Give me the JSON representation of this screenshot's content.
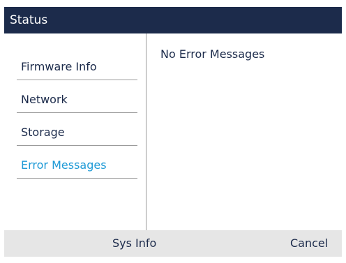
{
  "title": "Status",
  "menu": {
    "items": [
      {
        "label": "Firmware Info",
        "active": false
      },
      {
        "label": "Network",
        "active": false
      },
      {
        "label": "Storage",
        "active": false
      },
      {
        "label": "Error Messages",
        "active": true
      }
    ]
  },
  "content": {
    "message": "No Error Messages"
  },
  "softkeys": {
    "sys_info": "Sys Info",
    "cancel": "Cancel"
  },
  "colors": {
    "titlebar_bg": "#1c2b4b",
    "active_item": "#1e9ad6",
    "softkey_bg": "#e6e6e6",
    "text": "#1c2b4b"
  }
}
